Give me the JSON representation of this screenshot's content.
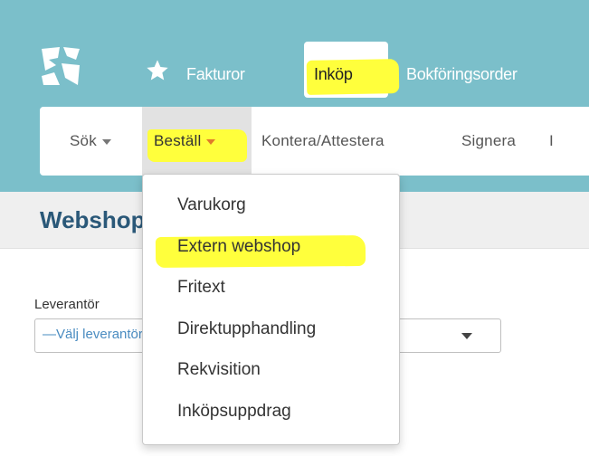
{
  "app": {
    "brand_color": "#7bbfca",
    "highlight_color": "#ffff3c",
    "logo_icon": "app-logo-icon",
    "favorites_icon": "star-icon"
  },
  "topnav": {
    "items": [
      {
        "label": "Fakturor"
      },
      {
        "label": "Inköp",
        "active": true
      },
      {
        "label": "Bokföringsorder"
      }
    ]
  },
  "subnav": {
    "items": [
      {
        "label": "Sök",
        "has_caret": true
      },
      {
        "label": "Beställ",
        "has_caret": true,
        "active": true
      },
      {
        "label": "Kontera/Attestera"
      },
      {
        "label": "Signera"
      },
      {
        "label": "I"
      }
    ]
  },
  "page": {
    "title": "Webshop"
  },
  "form": {
    "supplier_label": "Leverantör",
    "supplier_select_value": "—Välj leverantör—"
  },
  "dropdown": {
    "items": [
      {
        "label": "Varukorg"
      },
      {
        "label": "Extern webshop",
        "highlighted": true
      },
      {
        "label": "Fritext"
      },
      {
        "label": "Direktupphandling"
      },
      {
        "label": "Rekvisition"
      },
      {
        "label": "Inköpsuppdrag"
      }
    ]
  }
}
